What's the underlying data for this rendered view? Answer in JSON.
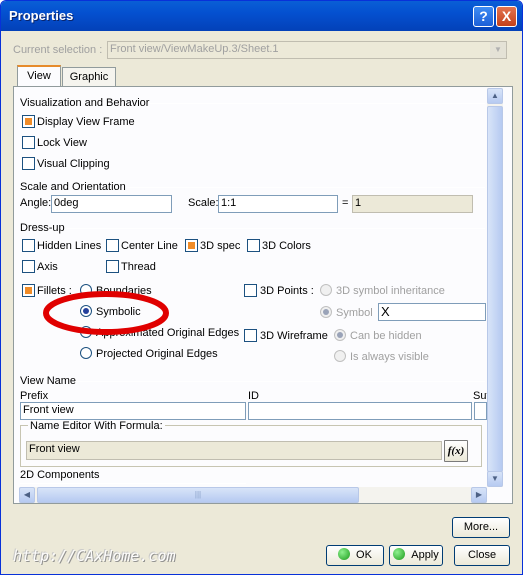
{
  "window": {
    "title": "Properties",
    "help_icon": "?",
    "close_icon": "X"
  },
  "current_selection": {
    "label": "Current selection :",
    "value": "Front view/ViewMakeUp.3/Sheet.1"
  },
  "tabs": [
    {
      "label": "View"
    },
    {
      "label": "Graphic"
    }
  ],
  "sections": {
    "visualization": {
      "title": "Visualization and Behavior",
      "items": [
        {
          "label": "Display View Frame",
          "checked": true
        },
        {
          "label": "Lock View",
          "checked": false
        },
        {
          "label": "Visual Clipping",
          "checked": false
        }
      ]
    },
    "scale": {
      "title": "Scale and Orientation",
      "angle_label": "Angle:",
      "angle_value": "0deg",
      "scale_label": "Scale:",
      "scale_value": "1:1",
      "equals": "=",
      "equals_value": "1"
    },
    "dressup": {
      "title": "Dress-up",
      "hidden_lines": "Hidden Lines",
      "center_line": "Center Line",
      "spec_3d": "3D spec",
      "colors_3d": "3D Colors",
      "axis": "Axis",
      "thread": "Thread",
      "fillets": "Fillets :",
      "boundaries": "Boundaries",
      "symbolic": "Symbolic",
      "approx_edges": "Approximated Original Edges",
      "projected_edges": "Projected Original Edges",
      "points_3d": "3D Points :",
      "symbol_inheritance": "3D symbol inheritance",
      "symbol": "Symbol",
      "symbol_value": "X",
      "wireframe_3d": "3D Wireframe",
      "can_be_hidden": "Can be hidden",
      "always_visible": "Is always visible"
    },
    "view_name": {
      "title": "View Name",
      "prefix_label": "Prefix",
      "id_label": "ID",
      "suffix_label": "Suf",
      "prefix_value": "Front view",
      "editor_label": "Name Editor With Formula:",
      "editor_value": "Front view",
      "formula_button": "f(x)"
    },
    "components": {
      "title": "2D Components"
    }
  },
  "buttons": {
    "more": "More...",
    "ok": "OK",
    "apply": "Apply",
    "close": "Close"
  },
  "watermark": "http://CAxHome.com",
  "colors": {
    "titlebar": "#0450d0",
    "highlight_ellipse": "#e00000",
    "checkbox_fill": "#f08c28"
  }
}
